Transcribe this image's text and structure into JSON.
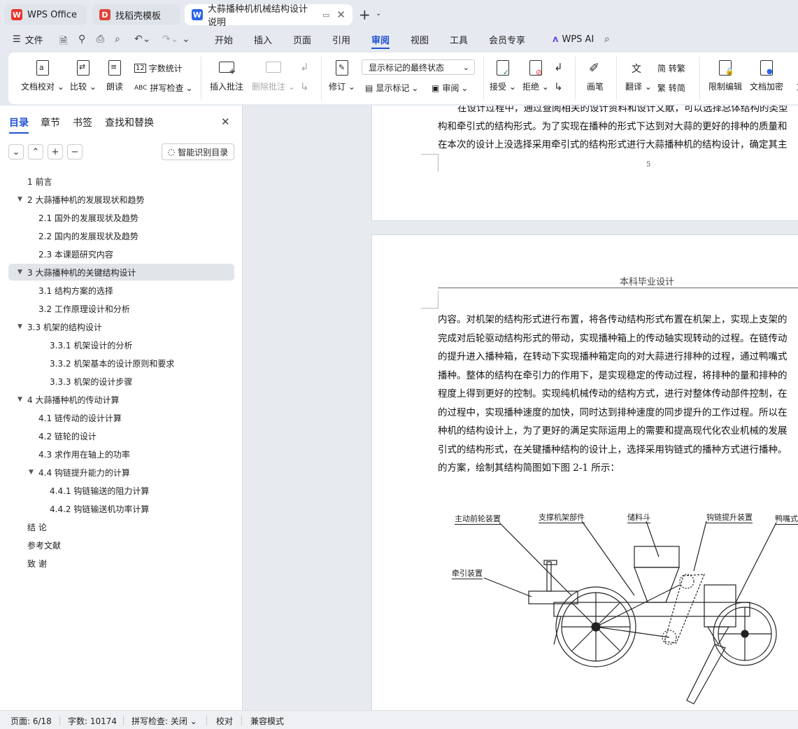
{
  "tabs": {
    "t1": "WPS Office",
    "t2": "找稻壳模板",
    "t3": "大蒜播种机机械结构设计 说明"
  },
  "menu": {
    "file": "文件",
    "m1": "开始",
    "m2": "插入",
    "m3": "页面",
    "m4": "引用",
    "m5": "审阅",
    "m6": "视图",
    "m7": "工具",
    "m8": "会员专享",
    "ai": "WPS AI"
  },
  "ribbon": {
    "proof": "文档校对",
    "compare": "比较",
    "read": "朗读",
    "wordcount": "字数统计",
    "spell": "拼写检查",
    "insert_comment": "插入批注",
    "delete_comment": "删除批注",
    "track": "修订",
    "markup_state": "显示标记的最终状态",
    "show_markup": "显示标记",
    "review": "审阅",
    "accept": "接受",
    "reject": "拒绝",
    "pen": "画笔",
    "translate": "翻译",
    "to_trad": "简 转繁",
    "to_simp": "繁 转简",
    "restrict": "限制编辑",
    "encrypt": "文档加密",
    "doc_cut": "文"
  },
  "panel": {
    "tab_toc": "目录",
    "tab_chapter": "章节",
    "tab_bookmark": "书签",
    "tab_find": "查找和替换",
    "smart": "智能识别目录"
  },
  "toc": [
    {
      "t": "1  前言"
    },
    {
      "t": "2  大蒜播种机的发展现状和趋势"
    },
    {
      "t": "2.1  国外的发展现状及趋势"
    },
    {
      "t": "2.2  国内的发展现状及趋势"
    },
    {
      "t": "2.3  本课题研究内容"
    },
    {
      "t": "3  大蒜播种机的关键结构设计"
    },
    {
      "t": "3.1 结构方案的选择"
    },
    {
      "t": "3.2  工作原理设计和分析"
    },
    {
      "t": "3.3 机架的结构设计"
    },
    {
      "t": "3.3.1 机架设计的分析"
    },
    {
      "t": "3.3.2 机架基本的设计原则和要求"
    },
    {
      "t": "3.3.3 机架的设计步骤"
    },
    {
      "t": "4  大蒜播种机的传动计算"
    },
    {
      "t": "4.1 链传动的设计计算"
    },
    {
      "t": "4.2 链轮的设计"
    },
    {
      "t": "4.3 求作用在轴上的功率"
    },
    {
      "t": "4.4 钩链提升能力的计算"
    },
    {
      "t": "4.4.1 钩链输送的阻力计算"
    },
    {
      "t": "4.4.2 钩链输送机功率计算"
    },
    {
      "t": "结  论"
    },
    {
      "t": "参考文献"
    },
    {
      "t": "致  谢"
    }
  ],
  "doc": {
    "p1": [
      "在设计过程中，通过查阅相关的设计资料和设计文献，可以选择总体结构的类型",
      "构和牵引式的结构形式。为了实现在播种的形式下达到对大蒜的更好的排种的质量和",
      "在本次的设计上没选择采用牵引式的结构形式进行大蒜播种机的结构设计，确定其主"
    ],
    "page_no": "5",
    "header": "本科毕业设计",
    "p2": [
      "内容。对机架的结构形式进行布置，将各传动结构形式布置在机架上，实现上支架的",
      "完成对后轮驱动结构形式的带动，实现播种箱上的传动轴实现转动的过程。在链传动",
      "的提升进入播种箱，在转动下实现播种箱定向的对大蒜进行排种的过程，通过鸭嘴式",
      "播种。整体的结构在牵引力的作用下，是实现稳定的传动过程，将排种的量和排种的",
      "程度上得到更好的控制。实现纯机械传动的结构方式，进行对整体传动部件控制，在",
      "的过程中，实现播种速度的加快，同时达到排种速度的同步提升的工作过程。所以在",
      "种机的结构设计上，为了更好的满足实际运用上的需要和提高现代化农业机械的发展",
      "引式的结构形式，在关键播种结构的设计上，选择采用钩链式的播种方式进行播种。",
      "的方案，绘制其结构简图如下图 2-1 所示："
    ],
    "labels": {
      "l1": "主动前轮装置",
      "l2": "支撑机架部件",
      "l3": "储料斗",
      "l4": "钩链提升装置",
      "l5": "鸭嘴式",
      "l6": "牵引装置"
    }
  },
  "status": {
    "page": "页面: 6/18",
    "words": "字数: 10174",
    "spell": "拼写检查: 关闭",
    "proof": "校对",
    "compat": "兼容模式"
  }
}
